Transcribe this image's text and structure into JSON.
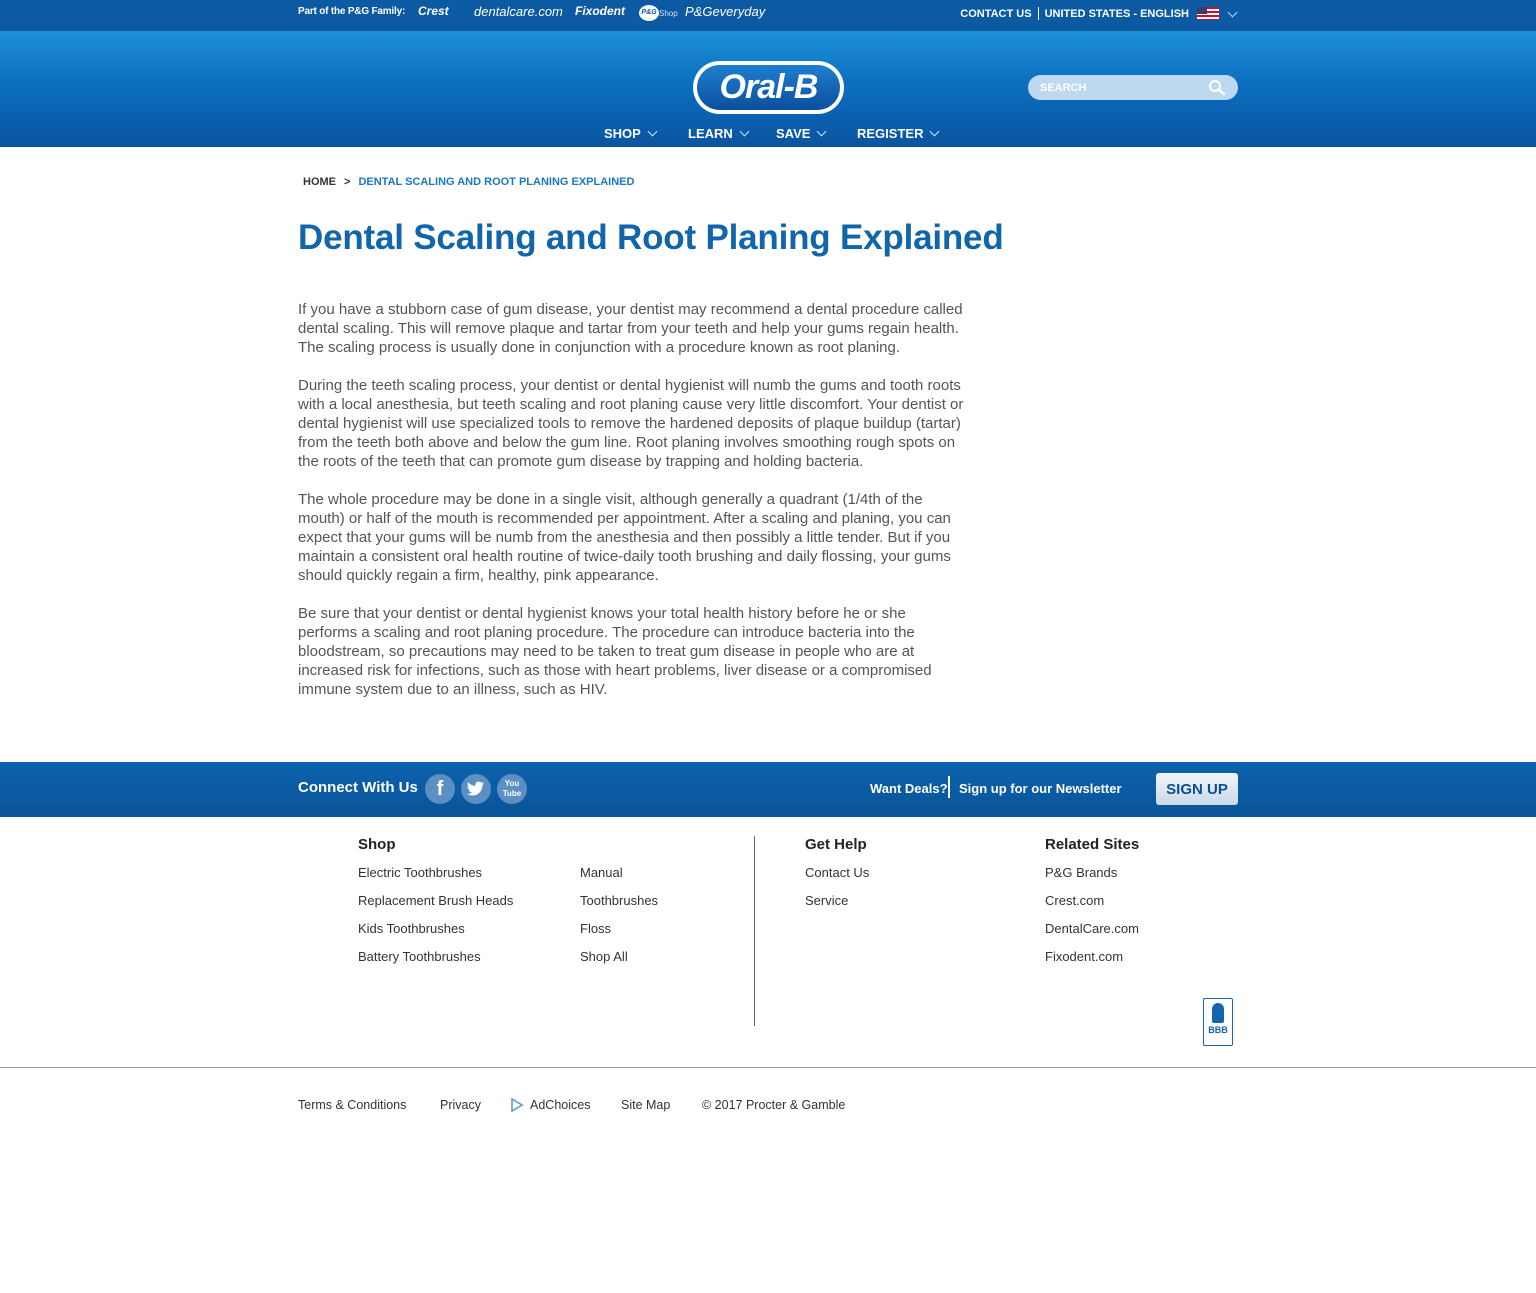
{
  "family_bar": {
    "label": "Part of the P&G Family:",
    "brands": [
      "Crest",
      "dentalcare.com",
      "Fixodent",
      "P&G",
      "Shop",
      "P&Geveryday"
    ],
    "contact": "CONTACT US",
    "region": "UNITED STATES - ENGLISH",
    "flag_icon": "us-flag-icon"
  },
  "header": {
    "logo": "Oral-B",
    "search_placeholder": "SEARCH",
    "nav": [
      "SHOP",
      "LEARN",
      "SAVE",
      "REGISTER"
    ]
  },
  "breadcrumb": {
    "home": "HOME",
    "separator": ">",
    "current": "DENTAL SCALING AND ROOT PLANING EXPLAINED"
  },
  "article": {
    "title": "Dental Scaling and Root Planing Explained",
    "paragraphs": [
      "If you have a stubborn case of gum disease, your dentist may recommend a dental procedure called dental scaling.  This will remove plaque and tartar from your teeth and help your gums regain health. The scaling process is usually done in conjunction with a procedure known as root planing.",
      "During the teeth scaling process, your dentist or dental hygienist will numb the gums and tooth roots with a local anesthesia, but teeth scaling and root planing cause very little discomfort. Your dentist or dental hygienist will use specialized tools to remove the hardened deposits of plaque buildup (tartar) from the teeth both above and below the gum line. Root planing involves smoothing rough spots on the roots of the teeth that can promote gum disease by trapping and holding bacteria.",
      "The whole procedure may be done in a single visit, although generally a quadrant (1/4th of the mouth) or half of the mouth is recommended per appointment. After a scaling and planing, you can expect that your gums will be numb from the anesthesia and then possibly a little tender. But if you maintain a consistent oral health routine of twice-daily tooth brushing and daily flossing, your gums should quickly regain a firm, healthy, pink appearance.",
      "Be sure that your dentist or dental hygienist knows your total health history before he or she performs a scaling and root planing procedure. The procedure can introduce bacteria into the bloodstream, so precautions may need to be taken to treat gum disease in people who are at increased risk for infections, such as those with heart problems, liver disease or a compromised immune system due to an illness, such as HIV."
    ]
  },
  "connect": {
    "label": "Connect With Us",
    "social": [
      {
        "icon": "facebook-icon",
        "glyph": "f"
      },
      {
        "icon": "twitter-icon",
        "glyph": "t"
      },
      {
        "icon": "youtube-icon",
        "glyph": "You Tube"
      }
    ],
    "deals": "Want Deals?",
    "newsletter": "Sign up for our Newsletter",
    "signup": "SIGN UP"
  },
  "footer": {
    "shop_title": "Shop",
    "shop_col1": [
      "Electric Toothbrushes",
      "Replacement Brush Heads",
      "Kids Toothbrushes",
      "Battery Toothbrushes"
    ],
    "shop_col2": [
      "Manual",
      "Toothbrushes",
      "Floss",
      "Shop All"
    ],
    "help_title": "Get Help",
    "help_links": [
      "Contact Us",
      "Service"
    ],
    "related_title": "Related Sites",
    "related_links": [
      "P&G Brands",
      "Crest.com",
      "DentalCare.com",
      "Fixodent.com"
    ],
    "bbb": "BBB"
  },
  "legal": {
    "terms": "Terms & Conditions",
    "privacy": "Privacy",
    "adchoices": "AdChoices",
    "sitemap": "Site Map",
    "copyright": "© 2017 Procter & Gamble"
  }
}
